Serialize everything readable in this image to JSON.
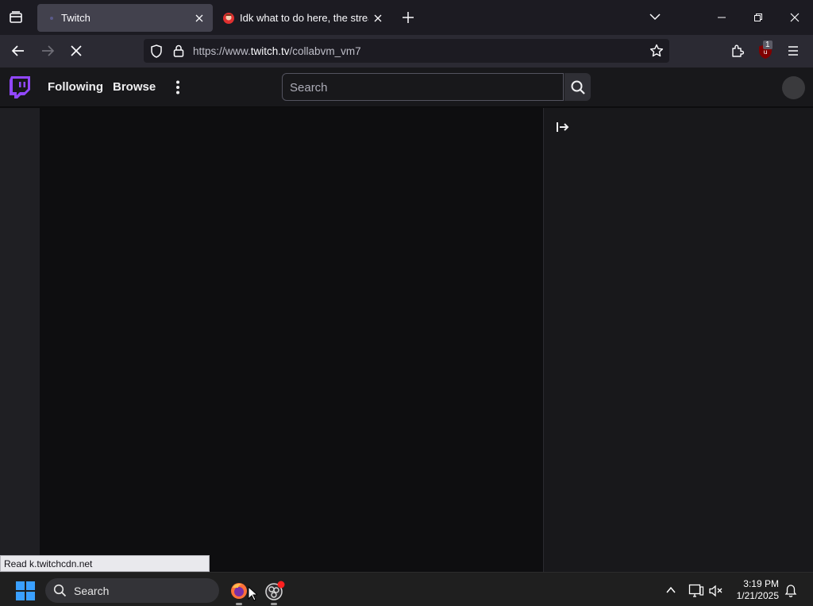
{
  "browser": {
    "tabs": [
      {
        "title": "Twitch",
        "active": true
      },
      {
        "title": "Idk what to do here, the stream",
        "active": false
      }
    ],
    "url_prefix": "https://www.",
    "url_domain": "twitch.tv",
    "url_path": "/collabvm_vm7",
    "extension_badge": "1",
    "status_text": "Read k.twitchcdn.net"
  },
  "twitch": {
    "nav": {
      "following": "Following",
      "browse": "Browse"
    },
    "search_placeholder": "Search"
  },
  "taskbar": {
    "search_placeholder": "Search",
    "time": "3:19 PM",
    "date": "1/21/2025"
  },
  "colors": {
    "twitch_purple": "#9147ff",
    "firefox_dark": "#1c1b22",
    "taskbar": "#1f1f1f"
  }
}
